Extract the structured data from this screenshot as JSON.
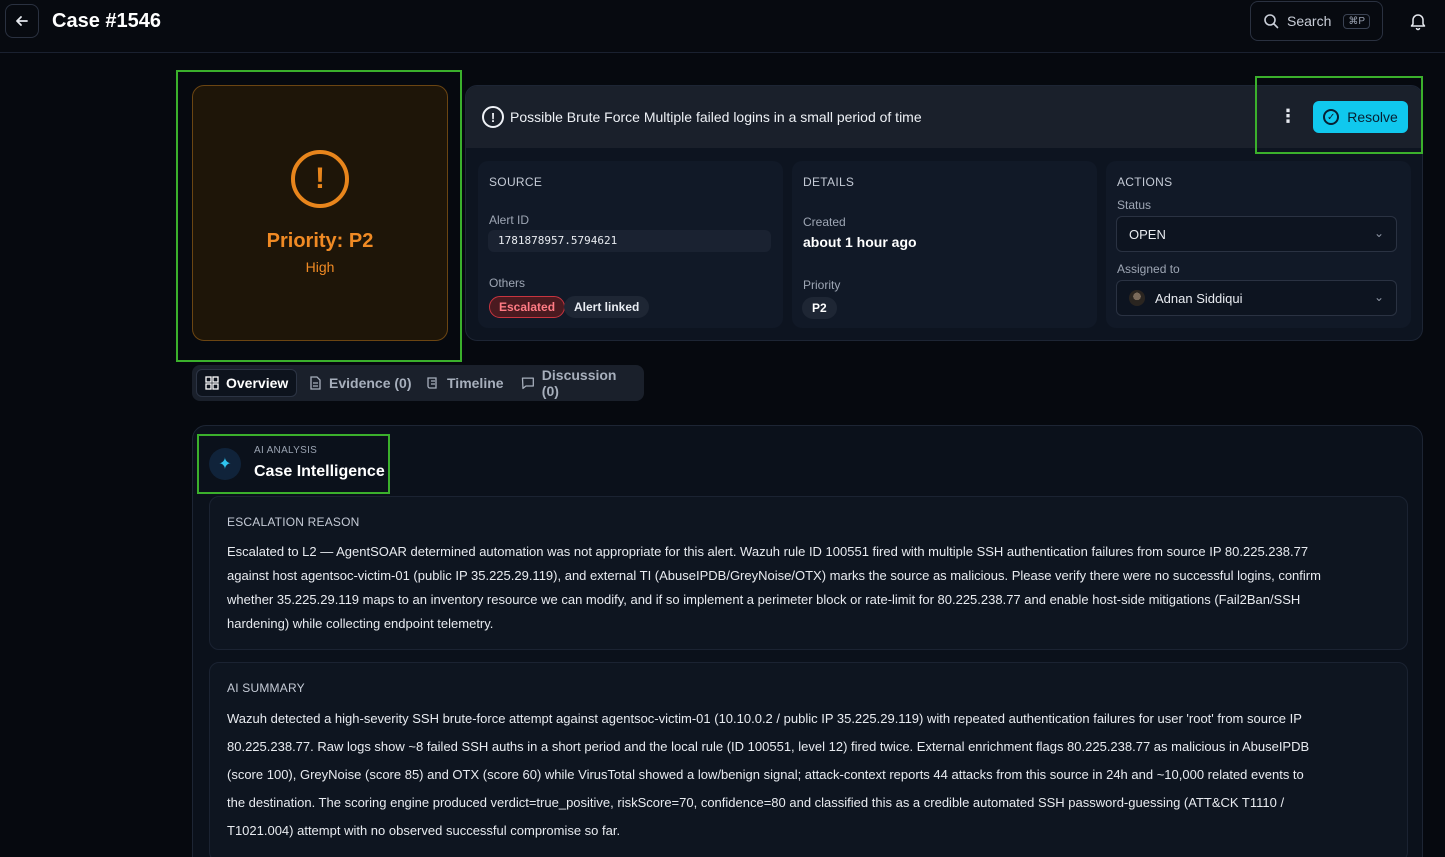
{
  "header": {
    "title": "Case #1546",
    "search_label": "Search",
    "search_shortcut": "⌘P"
  },
  "priority": {
    "title": "Priority: P2",
    "level": "High",
    "accent": "#f08a24"
  },
  "alert": {
    "headline": "Possible Brute Force Multiple failed logins in a small period of time",
    "resolve_label": "Resolve"
  },
  "source": {
    "heading": "SOURCE",
    "alert_id_label": "Alert ID",
    "alert_id": "1781878957.5794621",
    "others_label": "Others",
    "badges": [
      "Escalated",
      "Alert linked"
    ]
  },
  "details": {
    "heading": "DETAILS",
    "created_label": "Created",
    "created_value": "about 1 hour ago",
    "priority_label": "Priority",
    "priority_value": "P2"
  },
  "actions": {
    "heading": "ACTIONS",
    "status_label": "Status",
    "status_value": "OPEN",
    "assigned_label": "Assigned to",
    "assigned_value": "Adnan Siddiqui"
  },
  "tabs": [
    {
      "label": "Overview",
      "icon": "grid-icon",
      "active": true
    },
    {
      "label": "Evidence (0)",
      "icon": "document-icon",
      "active": false
    },
    {
      "label": "Timeline",
      "icon": "scroll-icon",
      "active": false
    },
    {
      "label": "Discussion (0)",
      "icon": "chat-icon",
      "active": false
    }
  ],
  "intelligence": {
    "kicker": "AI ANALYSIS",
    "title": "Case Intelligence",
    "escalation_heading": "ESCALATION REASON",
    "escalation_lines": [
      "Escalated to L2 — AgentSOAR determined automation was not appropriate for this alert. Wazuh rule ID 100551 fired with multiple SSH authentication failures from source IP 80.225.238.77",
      "against host agentsoc-victim-01 (public IP 35.225.29.119), and external TI (AbuseIPDB/GreyNoise/OTX) marks the source as malicious. Please verify there were no successful logins, confirm",
      "whether 35.225.29.119 maps to an inventory resource we can modify, and if so implement a perimeter block or rate-limit for 80.225.238.77 and enable host-side mitigations (Fail2Ban/SSH",
      "hardening) while collecting endpoint telemetry."
    ],
    "summary_heading": "AI SUMMARY",
    "summary_lines": [
      "Wazuh detected a high-severity SSH brute-force attempt against agentsoc-victim-01 (10.10.0.2 / public IP 35.225.29.119) with repeated authentication failures for user 'root' from source IP",
      "80.225.238.77. Raw logs show ~8 failed SSH auths in a short period and the local rule (ID 100551, level 12) fired twice. External enrichment flags 80.225.238.77 as malicious in AbuseIPDB",
      "(score 100), GreyNoise (score 85) and OTX (score 60) while VirusTotal showed a low/benign signal; attack-context reports 44 attacks from this source in 24h and ~10,000 related events to",
      "the destination. The scoring engine produced verdict=true_positive, riskScore=70, confidence=80 and classified this as a credible automated SSH password-guessing (ATT&CK T1110 /",
      "T1021.004) attempt with no observed successful compromise so far."
    ]
  }
}
